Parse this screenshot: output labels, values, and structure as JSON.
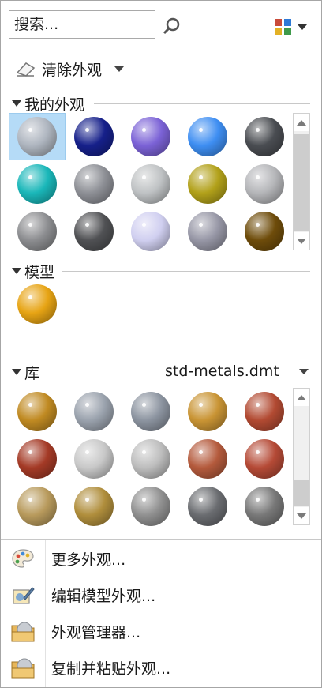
{
  "search": {
    "placeholder": "搜索..."
  },
  "clear_appearance": {
    "label": "清除外观"
  },
  "sections": {
    "my_appearances": {
      "label": "我的外观"
    },
    "model": {
      "label": "模型"
    },
    "library": {
      "label": "库",
      "file": "std-metals.dmt"
    }
  },
  "my_appearances_swatches": [
    "#aeb5bf",
    "#16208a",
    "#7b62d6",
    "#3e8ef2",
    "#4a4d52",
    "#1ab7b9",
    "#8e9096",
    "#bfc2c4",
    "#b2a11a",
    "#b5b6b9",
    "#8c8d90",
    "#505154",
    "#d0cff0",
    "#9797a6",
    "#6e4c0a"
  ],
  "model_swatches": [
    "#e7a414"
  ],
  "library_swatches": [
    "#c08a22",
    "#9aa2ad",
    "#8c94a0",
    "#c99434",
    "#b24a32",
    "#a43a26",
    "#c8c8c8",
    "#bdbdbd",
    "#b45a3c",
    "#b54a36",
    "#b89a5c",
    "#b08e3c",
    "#909090",
    "#6a6c70",
    "#787878"
  ],
  "menu": [
    {
      "label": "更多外观...",
      "icon": "palette-icon"
    },
    {
      "label": "编辑模型外观...",
      "icon": "edit-appearance-icon"
    },
    {
      "label": "外观管理器...",
      "icon": "appearance-manager-icon"
    },
    {
      "label": "复制并粘贴外观...",
      "icon": "copy-paste-appearance-icon"
    }
  ]
}
